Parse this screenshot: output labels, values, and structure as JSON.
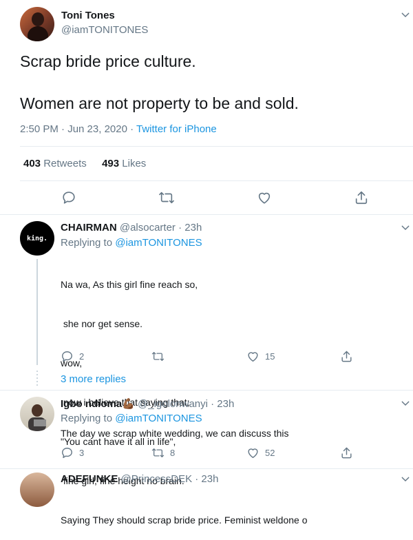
{
  "tweet": {
    "author_name": "Toni Tones",
    "author_handle": "@iamTONITONES",
    "text_line1": "Scrap bride price culture.",
    "text_line2": "Women are not property to be and sold.",
    "time": "2:50 PM · Jun 23, 2020 · ",
    "source": "Twitter for iPhone",
    "retweets_count": "403",
    "retweets_label": "Retweets",
    "likes_count": "493",
    "likes_label": "Likes"
  },
  "replies": [
    {
      "name": "CHAIRMAN",
      "handle": "@alsocarter · 23h",
      "replying_prefix": "Replying to ",
      "replying_to": "@iamTONITONES",
      "avatar_text": "king.",
      "lines": [
        "Na wa, As this girl fine reach so,",
        " she nor get sense.",
        "wow,",
        " now i believe that saying that;",
        "\"You cant have it all in life\",",
        " fine girl, fine height no brain.",
        "Saying They should scrap bride price. Feminist weldone o"
      ],
      "reply_count": "2",
      "retweet_count": "",
      "like_count": "15",
      "more_replies": "3 more replies"
    },
    {
      "name": "Igbo ndioma💪🏾",
      "handle": "@_igolonwanyi · 23h",
      "replying_prefix": "Replying to ",
      "replying_to": "@iamTONITONES",
      "text": "The day we scrap white wedding, we can discuss this",
      "reply_count": "3",
      "retweet_count": "8",
      "like_count": "52"
    },
    {
      "name": "ADEFUNKE",
      "handle": "@PrincessDEK · 23h"
    }
  ],
  "colors": {
    "accent": "#1b95e0",
    "muted": "#657786",
    "divider": "#e6ecf0"
  }
}
